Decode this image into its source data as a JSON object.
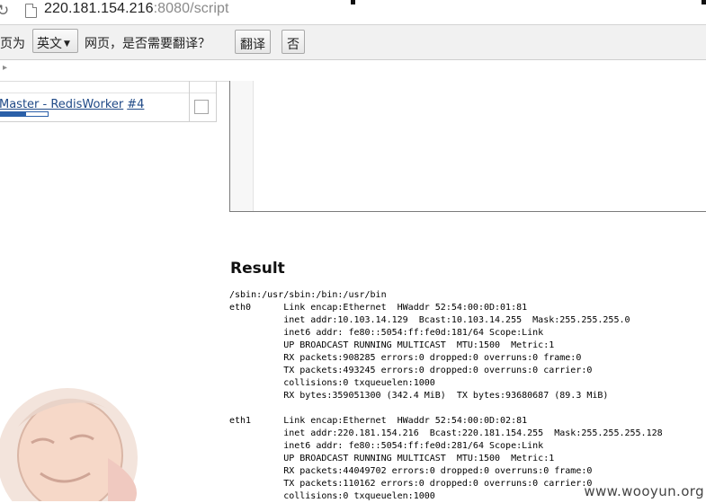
{
  "browser": {
    "url_host": "220.181.154.216",
    "url_rest": ":8080/script"
  },
  "translate_bar": {
    "prefix": "页为",
    "language": "英文",
    "question": "网页，是否需要翻译？",
    "translate_label": "翻译",
    "no_label": "否"
  },
  "sidebar": {
    "job_link": "Master - RedisWorker",
    "job_number": "#4",
    "progress_percent": 55
  },
  "result": {
    "title": "Result",
    "output_lines": [
      "/sbin:/usr/sbin:/bin:/usr/bin",
      "eth0      Link encap:Ethernet  HWaddr 52:54:00:0D:01:81",
      "          inet addr:10.103.14.129  Bcast:10.103.14.255  Mask:255.255.255.0",
      "          inet6 addr: fe80::5054:ff:fe0d:181/64 Scope:Link",
      "          UP BROADCAST RUNNING MULTICAST  MTU:1500  Metric:1",
      "          RX packets:908285 errors:0 dropped:0 overruns:0 frame:0",
      "          TX packets:493245 errors:0 dropped:0 overruns:0 carrier:0",
      "          collisions:0 txqueuelen:1000",
      "          RX bytes:359051300 (342.4 MiB)  TX bytes:93680687 (89.3 MiB)",
      "",
      "eth1      Link encap:Ethernet  HWaddr 52:54:00:0D:02:81",
      "          inet addr:220.181.154.216  Bcast:220.181.154.255  Mask:255.255.255.128",
      "          inet6 addr: fe80::5054:ff:fe0d:281/64 Scope:Link",
      "          UP BROADCAST RUNNING MULTICAST  MTU:1500  Metric:1",
      "          RX packets:44049702 errors:0 dropped:0 overruns:0 frame:0",
      "          TX packets:110162 errors:0 dropped:0 overruns:0 carrier:0",
      "          collisions:0 txqueuelen:1000"
    ]
  },
  "watermark": "www.wooyun.org",
  "icons": {
    "reload": "reload-icon",
    "page": "page-icon",
    "caret": "chevron-down-icon",
    "expand": "chevron-right-icon",
    "mascot": "jenkins-mascot-image"
  },
  "colors": {
    "link": "#204a87",
    "progress": "#2a5fa8",
    "translate_bar_bg": "#f1f1f1"
  }
}
